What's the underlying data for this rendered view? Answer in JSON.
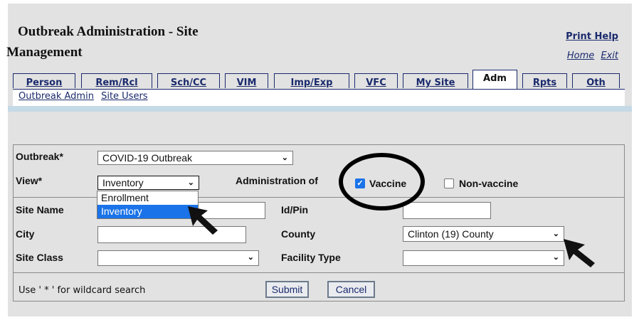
{
  "header": {
    "title_line1": "Outbreak Administration - Site",
    "title_line2": "Management",
    "print_help": "Print Help",
    "home": "Home",
    "exit": "Exit"
  },
  "tabs": [
    {
      "label": "Person"
    },
    {
      "label": "Rem/Rcl"
    },
    {
      "label": "Sch/CC"
    },
    {
      "label": "VIM"
    },
    {
      "label": "Imp/Exp"
    },
    {
      "label": "VFC"
    },
    {
      "label": "My Site"
    },
    {
      "label": "Adm",
      "active": true
    },
    {
      "label": "Rpts"
    },
    {
      "label": "Oth"
    }
  ],
  "subnav": {
    "outbreak_admin": "Outbreak Admin",
    "site_users": "Site Users"
  },
  "form": {
    "outbreak_label": "Outbreak*",
    "outbreak_value": "COVID-19 Outbreak",
    "view_label": "View*",
    "view_value": "Inventory",
    "view_options": [
      "Enrollment",
      "Inventory"
    ],
    "admin_of_label": "Administration of",
    "vaccine_label": "Vaccine",
    "vaccine_checked": true,
    "nonvaccine_label": "Non-vaccine",
    "nonvaccine_checked": false,
    "site_name_label": "Site Name",
    "site_name_value": "",
    "idpin_label": "Id/Pin",
    "idpin_value": "",
    "city_label": "City",
    "city_value": "",
    "county_label": "County",
    "county_value": "Clinton (19) County",
    "site_class_label": "Site Class",
    "site_class_value": "",
    "facility_type_label": "Facility Type",
    "facility_type_value": "",
    "wildcard_hint": "Use ' * ' for wildcard search",
    "submit": "Submit",
    "cancel": "Cancel"
  },
  "colors": {
    "link": "#1a2a6c",
    "checkbox_accent": "#1a73e8",
    "panel_bg": "#e2e2e2",
    "subbar": "#c5d9e6"
  },
  "annotations": {
    "icons": [
      "pointer-arrow-icon",
      "pointer-arrow-icon",
      "highlight-circle"
    ]
  }
}
